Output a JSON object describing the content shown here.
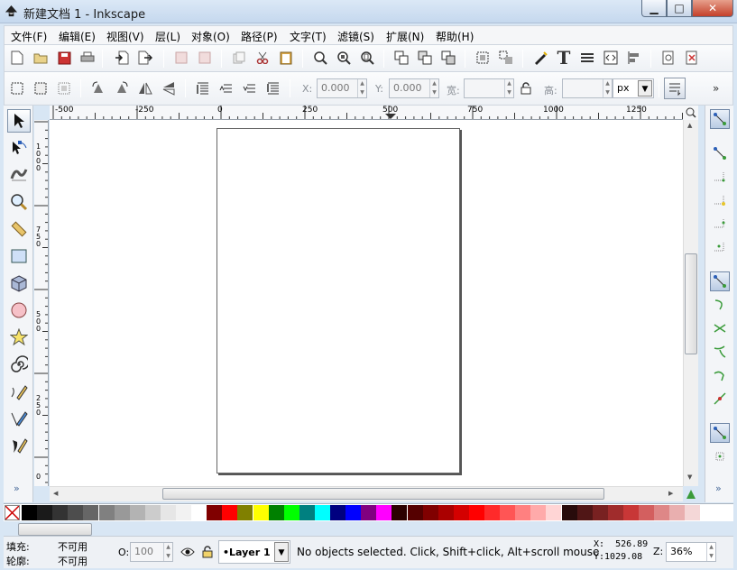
{
  "window": {
    "title": "新建文档 1 - Inkscape",
    "min_glyph": "▁",
    "max_glyph": "□",
    "close_glyph": "✕"
  },
  "menu": [
    "文件(F)",
    "编辑(E)",
    "视图(V)",
    "层(L)",
    "对象(O)",
    "路径(P)",
    "文字(T)",
    "滤镜(S)",
    "扩展(N)",
    "帮助(H)"
  ],
  "toolbar2": {
    "x_label": "X:",
    "x_value": "0.000",
    "y_label": "Y:",
    "y_value": "0.000",
    "w_label": "宽:",
    "w_value": "",
    "h_label": "高:",
    "h_value": "",
    "unit": "px",
    "overflow": "»"
  },
  "ruler": {
    "h_ticks": [
      "-500",
      "-250",
      "0",
      "250",
      "500",
      "750",
      "1000",
      "1250"
    ],
    "v_labels": [
      "1000",
      "750",
      "500",
      "250",
      "0"
    ]
  },
  "palette": {
    "colors": [
      "#000000",
      "#1a1a1a",
      "#333333",
      "#4d4d4d",
      "#666666",
      "#808080",
      "#999999",
      "#b3b3b3",
      "#cccccc",
      "#e6e6e6",
      "#f2f2f2",
      "#ffffff",
      "#800000",
      "#ff0000",
      "#808000",
      "#ffff00",
      "#008000",
      "#00ff00",
      "#008080",
      "#00ffff",
      "#000080",
      "#0000ff",
      "#800080",
      "#ff00ff",
      "#2b0000",
      "#550000",
      "#800000",
      "#aa0000",
      "#d40000",
      "#ff0000",
      "#ff2a2a",
      "#ff5555",
      "#ff8080",
      "#ffaaaa",
      "#ffd5d5",
      "#280b0b",
      "#501616",
      "#782121",
      "#a02c2c",
      "#c83737",
      "#d35f5f",
      "#de8787",
      "#e9afaf",
      "#f4d7d7"
    ]
  },
  "status": {
    "fill_label": "填充:",
    "fill_value": "不可用",
    "stroke_label": "轮廓:",
    "stroke_value": "不可用",
    "opacity_label": "O:",
    "opacity_value": "100",
    "layer": "•Layer 1",
    "message": "No objects selected. Click, Shift+click, Alt+scroll mouse",
    "x_coord": "X:  526.89",
    "y_coord": "Y:1029.08",
    "zoom_label": "Z:",
    "zoom_value": "36%"
  },
  "toolbox_overflow": "»",
  "snap_overflow": "»"
}
